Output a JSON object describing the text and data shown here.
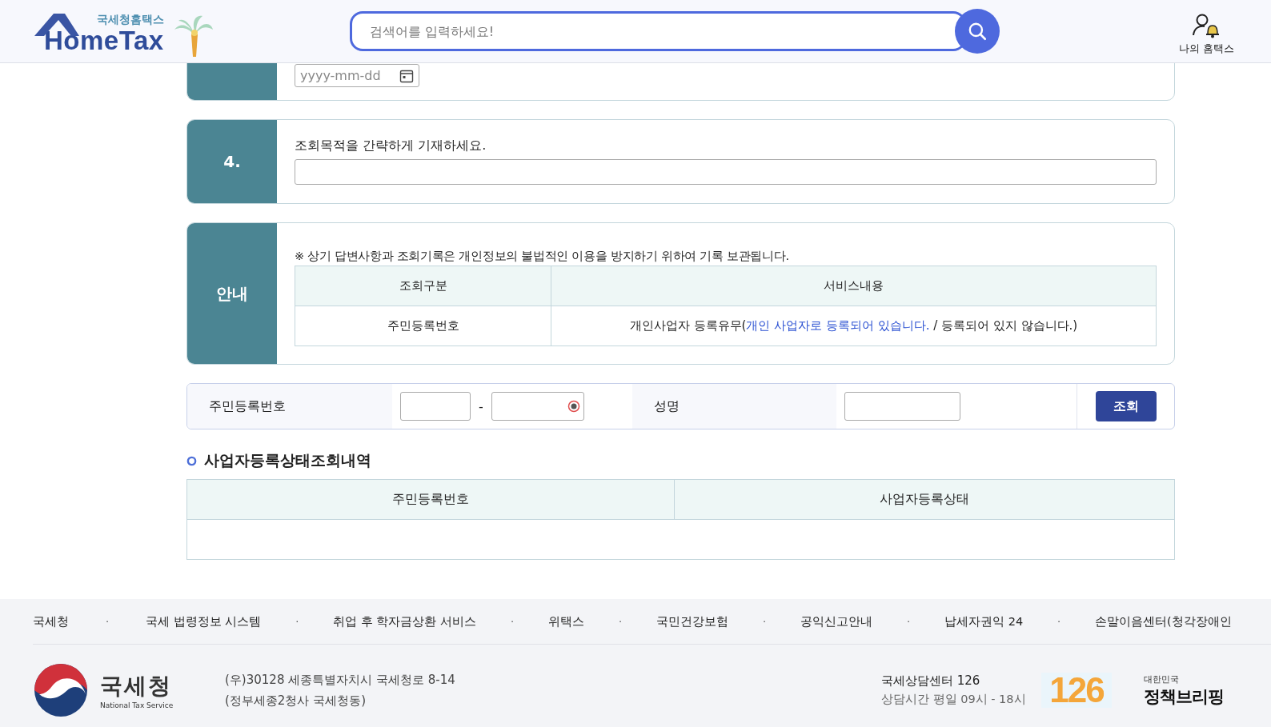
{
  "header": {
    "logo_caption": "국세청홈택스",
    "logo_title": "HomeTax",
    "search": {
      "placeholder": "검색어를 입력하세요!"
    },
    "my_link": "나의 홈택스"
  },
  "sections": [
    {
      "kind": "date",
      "date_field": {
        "placeholder": "yyyy-mm-dd"
      }
    },
    {
      "kind": "text",
      "label": "4.",
      "prompt": "조회목적을 간략하게 기재하세요."
    },
    {
      "kind": "notice",
      "label": "안내",
      "note": "※ 상기 답변사항과 조회기록은 개인정보의 불법적인 이용을 방지하기 위하여 기록 보관됩니다.",
      "table": {
        "columns": [
          "조회구분",
          "서비스내용"
        ],
        "rows": [
          {
            "category": "주민등록번호",
            "content": [
              {
                "kind": "plain",
                "text": "개인사업자 등록유무("
              },
              {
                "kind": "emphasis",
                "text": "개인 사업자로 등록되어 있습니다."
              },
              {
                "kind": "plain",
                "text": " / 등록되어 있지 않습니다.)"
              }
            ]
          }
        ]
      }
    }
  ],
  "search_form": {
    "id_label": "주민등록번호",
    "separator": "-",
    "name_label": "성명",
    "button": "조회"
  },
  "results": {
    "title": "사업자등록상태조회내역",
    "columns": [
      "주민등록번호",
      "사업자등록상태"
    ]
  },
  "footer": {
    "links": [
      "국세청",
      "국세 법령정보 시스템",
      "취업 후 학자금상환 서비스",
      "위택스",
      "국민건강보험",
      "공익신고안내",
      "납세자권익 24",
      "손말이음센터(청각장애인"
    ],
    "separator": "·",
    "org_name": "국세청",
    "org_english": "National Tax Service",
    "address": [
      "(우)30128 세종특별자치시 국세청로 8-14",
      "(정부세종2청사 국세청동)"
    ],
    "center": "국세상담센터 126",
    "hours": "상담시간 평일 09시 - 18시",
    "center_badge": "126",
    "briefing_small": "대한민국",
    "briefing": "정책브리핑"
  }
}
